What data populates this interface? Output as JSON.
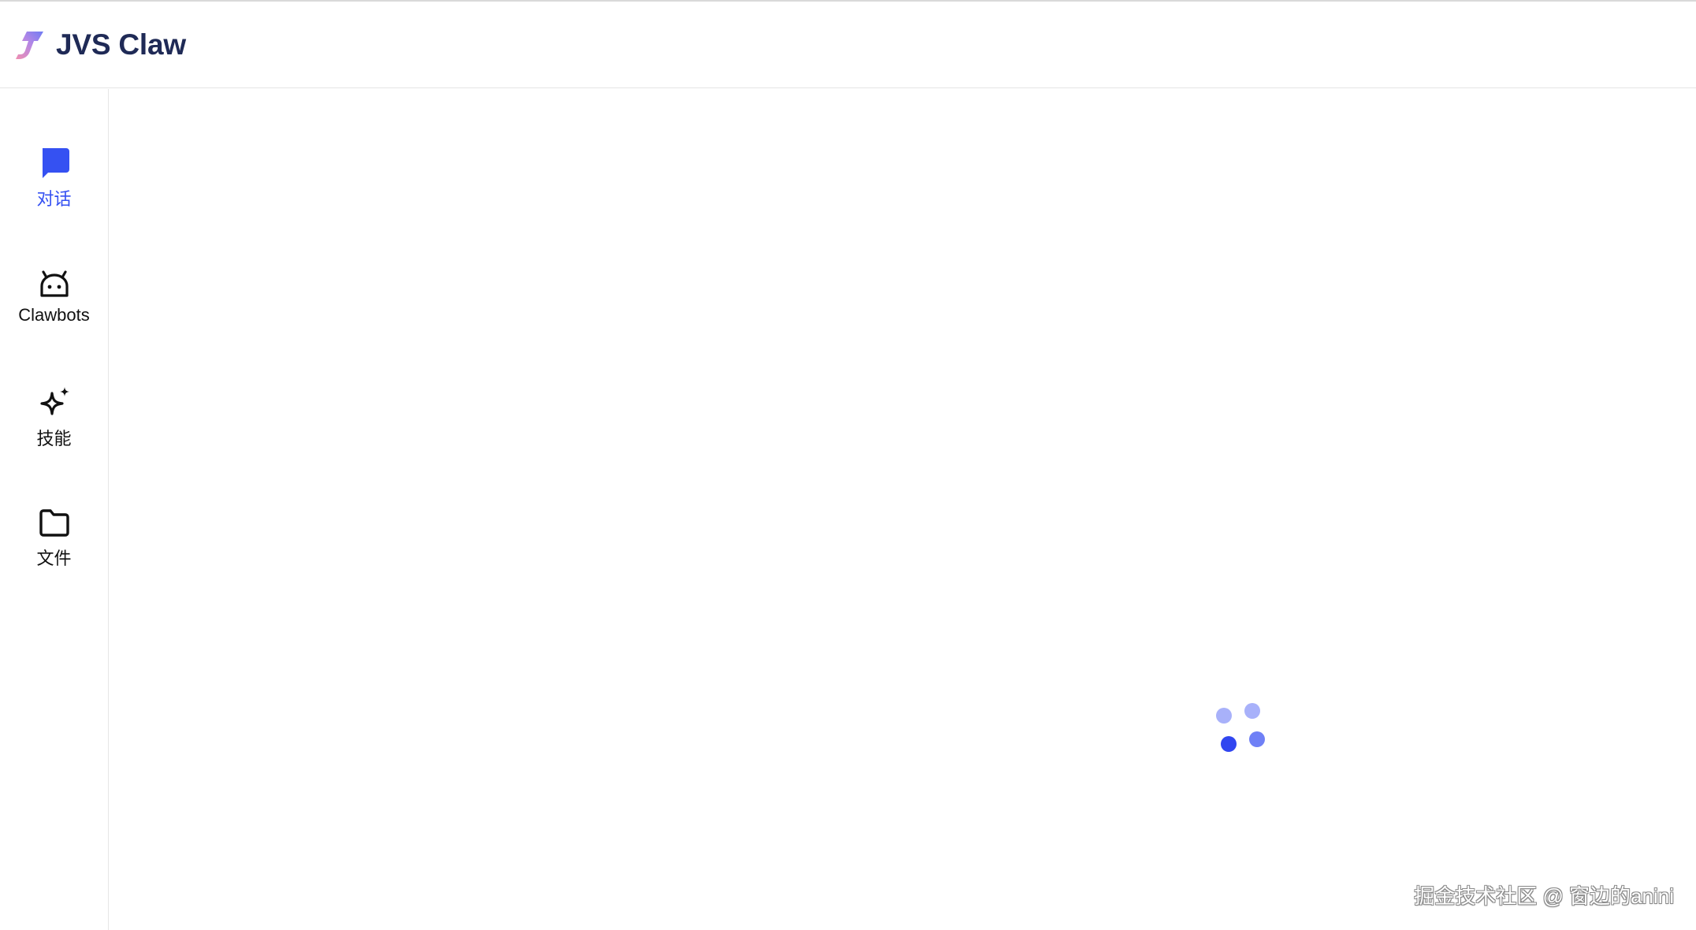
{
  "header": {
    "brand_title": "JVS Claw",
    "logo_icon": "jvs-claw-logo"
  },
  "sidebar": {
    "items": [
      {
        "label": "对话",
        "icon": "chat-bubble-icon",
        "active": true
      },
      {
        "label": "Clawbots",
        "icon": "robot-icon",
        "active": false
      },
      {
        "label": "技能",
        "icon": "sparkle-icon",
        "active": false
      },
      {
        "label": "文件",
        "icon": "folder-icon",
        "active": false
      }
    ]
  },
  "main": {
    "loader_icon": "loading-dots-icon"
  },
  "watermark": {
    "text": "掘金技术社区 @ 窗边的anini"
  },
  "colors": {
    "accent": "#3551f2",
    "brand_text": "#1f2a56",
    "loader_light": "#a8b1fa",
    "loader_mid": "#6f80f6",
    "loader_dark": "#3146f0"
  }
}
